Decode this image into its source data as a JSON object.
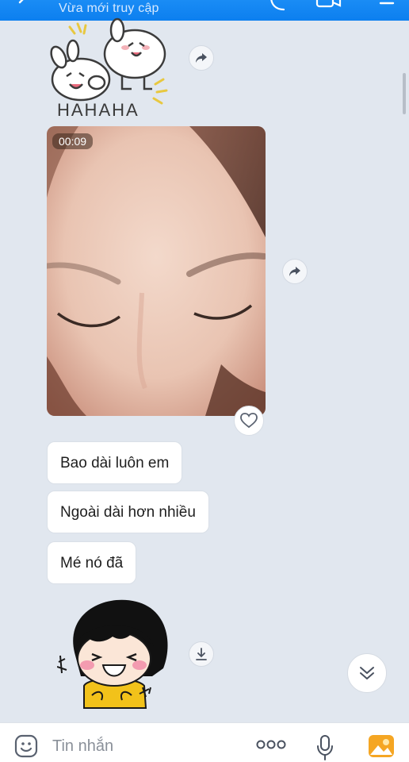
{
  "header": {
    "status_text": "Vừa mới truy cập",
    "icons": [
      "back-icon",
      "phone-icon",
      "video-call-icon",
      "menu-icon"
    ],
    "bg_color": "#0c7fef"
  },
  "messages": {
    "sticker_top": {
      "text": "HAHAHA"
    },
    "video": {
      "duration": "00:09"
    },
    "bubbles": [
      {
        "text": "Bao dài luôn em"
      },
      {
        "text": "Ngoài dài hơn nhiều"
      },
      {
        "text": "Mé nó đã"
      }
    ]
  },
  "input": {
    "placeholder": "Tin nhắn",
    "icons": [
      "emoji-icon",
      "more-icon",
      "mic-icon",
      "gallery-icon"
    ]
  },
  "colors": {
    "chat_bg": "#e1e7ef",
    "accent": "#0c7fef"
  }
}
